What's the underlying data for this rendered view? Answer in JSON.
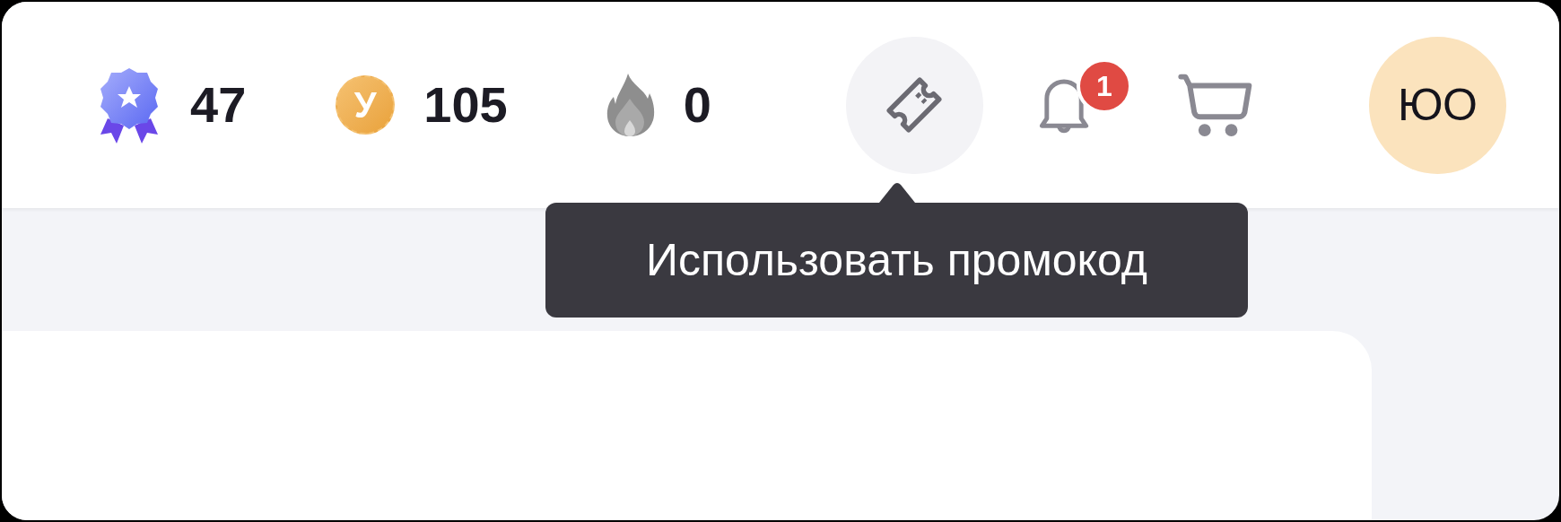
{
  "stats": [
    {
      "kind": "rating",
      "value": "47"
    },
    {
      "kind": "coins",
      "value": "105",
      "coin_letter": "У"
    },
    {
      "kind": "streak",
      "value": "0"
    }
  ],
  "promo_button": {
    "highlighted": true,
    "tooltip": "Использовать промокод"
  },
  "notifications": {
    "count": "1"
  },
  "avatar": {
    "initials": "ЮО"
  }
}
